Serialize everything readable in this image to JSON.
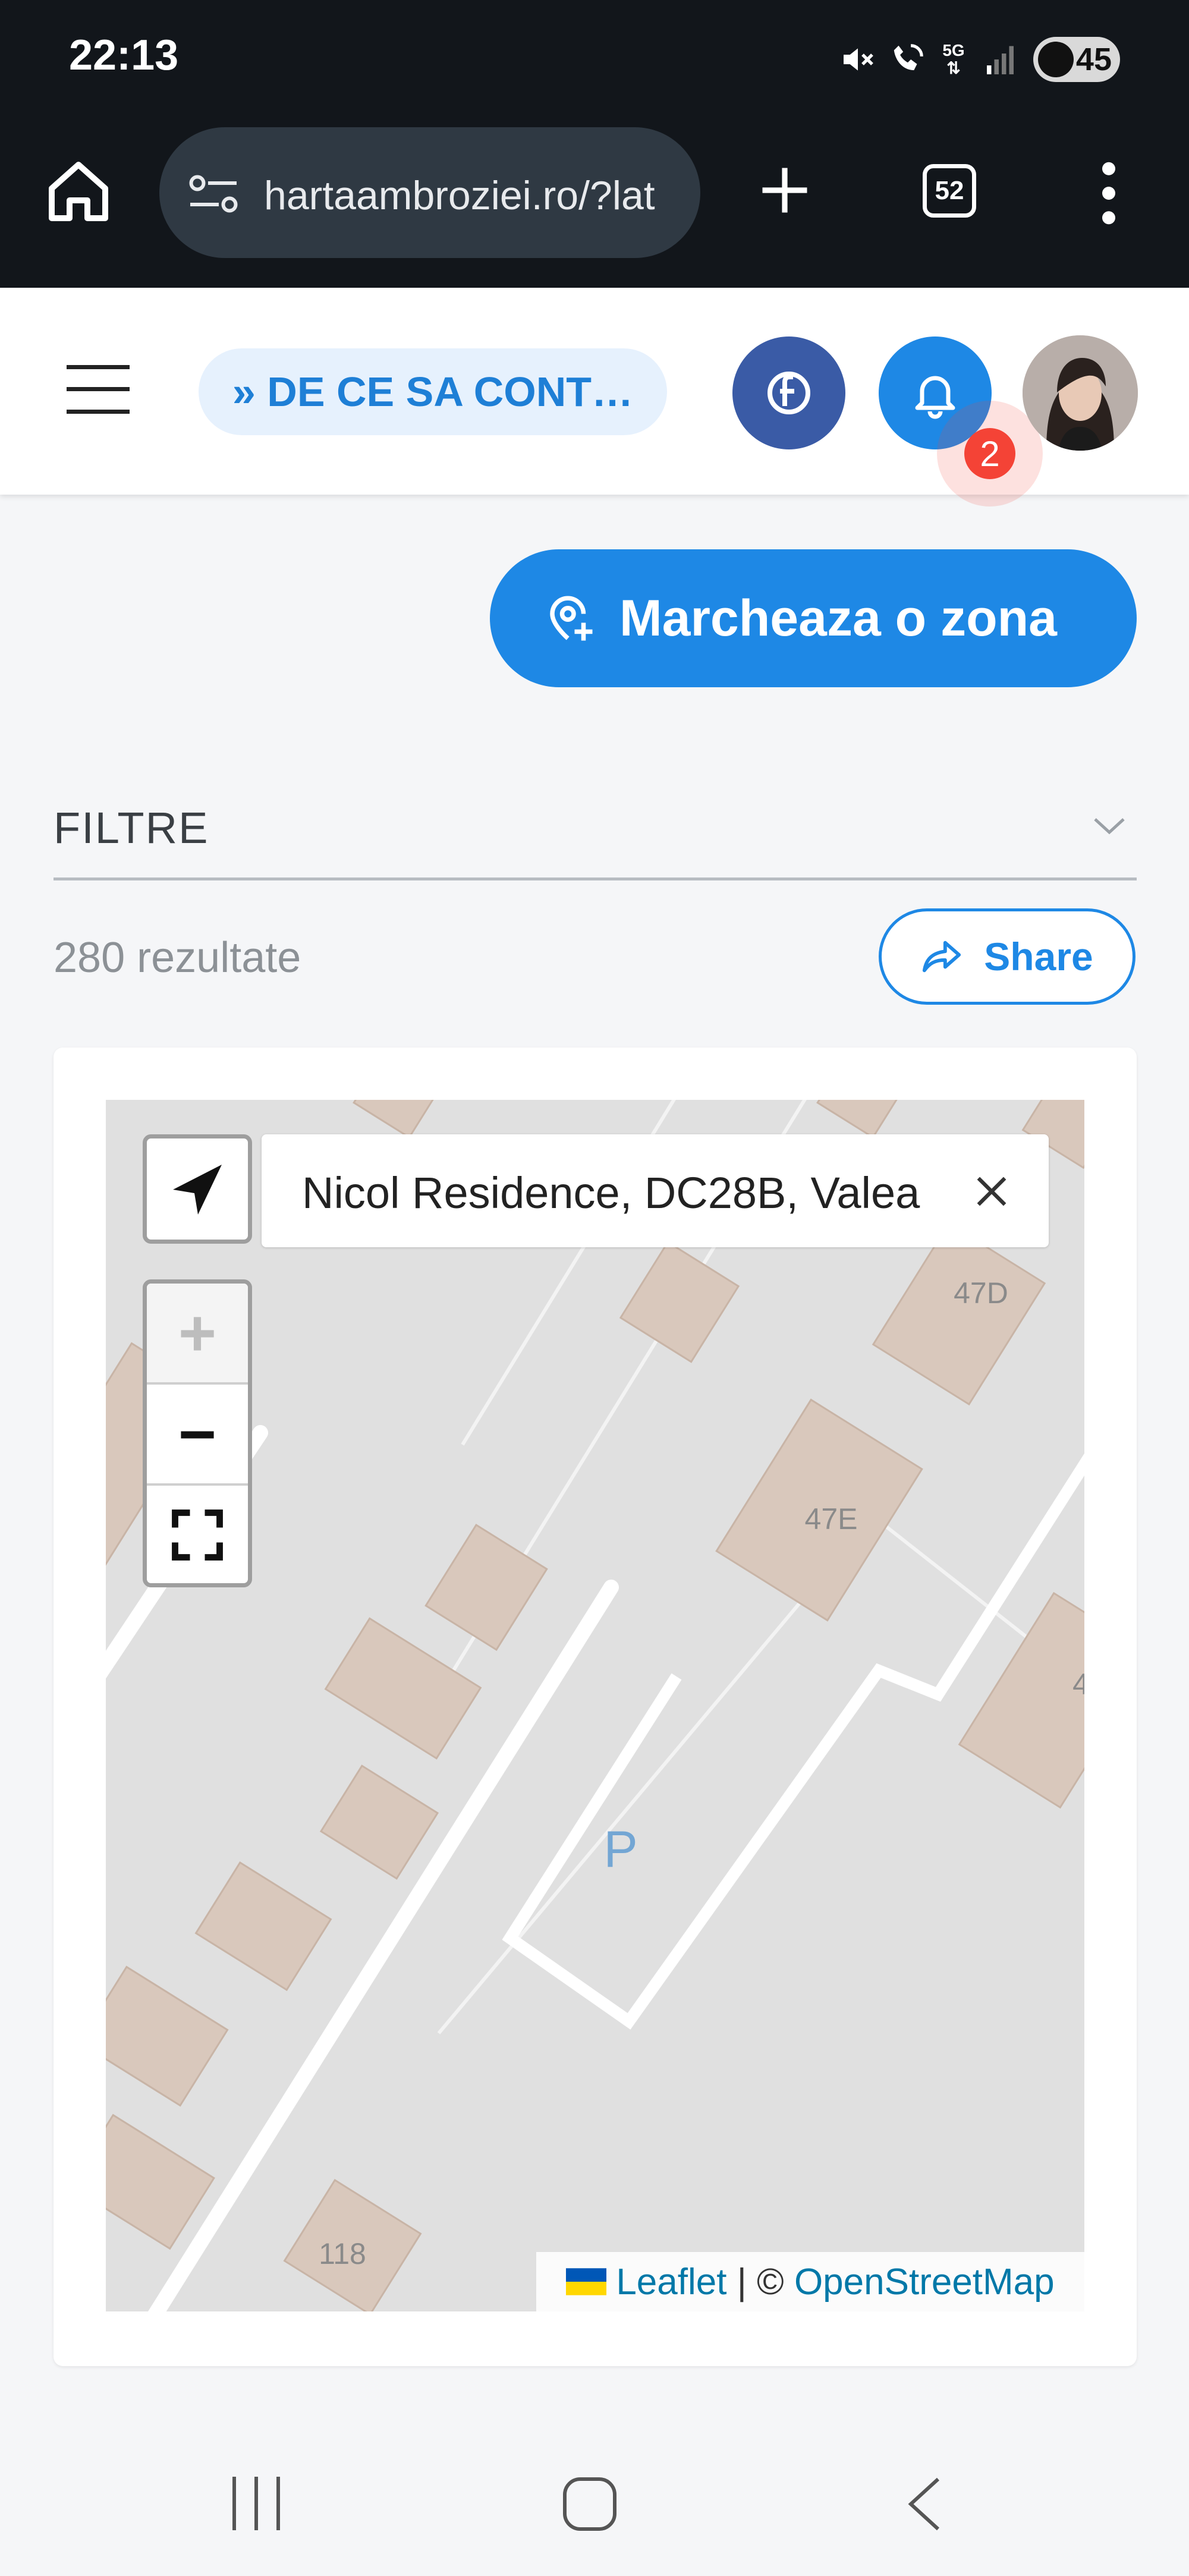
{
  "status_bar": {
    "time": "22:13",
    "battery": "45",
    "network": "5G"
  },
  "browser": {
    "url": "hartaambroziei.ro/?lat",
    "tab_count": "52"
  },
  "header": {
    "promo_link": "» DE CE SA CONT…",
    "notification_count": "2"
  },
  "actions": {
    "mark_zone_label": "Marcheaza o zona"
  },
  "filters": {
    "title": "FILTRE"
  },
  "results": {
    "count_label": "280 rezultate",
    "share_label": "Share"
  },
  "map": {
    "search_value": "Nicol Residence, DC28B, Valea",
    "zoom_in_label": "+",
    "zoom_out_label": "−",
    "labels": {
      "building_a": "47D",
      "building_b": "47E",
      "building_c": "4",
      "parking": "P",
      "building_d": "118"
    },
    "attribution": {
      "leaflet": "Leaflet",
      "separator": " | © ",
      "osm": "OpenStreetMap"
    }
  },
  "colors": {
    "accent": "#1e88e5",
    "facebook": "#3a5ba6",
    "badge": "#f44336",
    "building": "#d9c8bc"
  }
}
